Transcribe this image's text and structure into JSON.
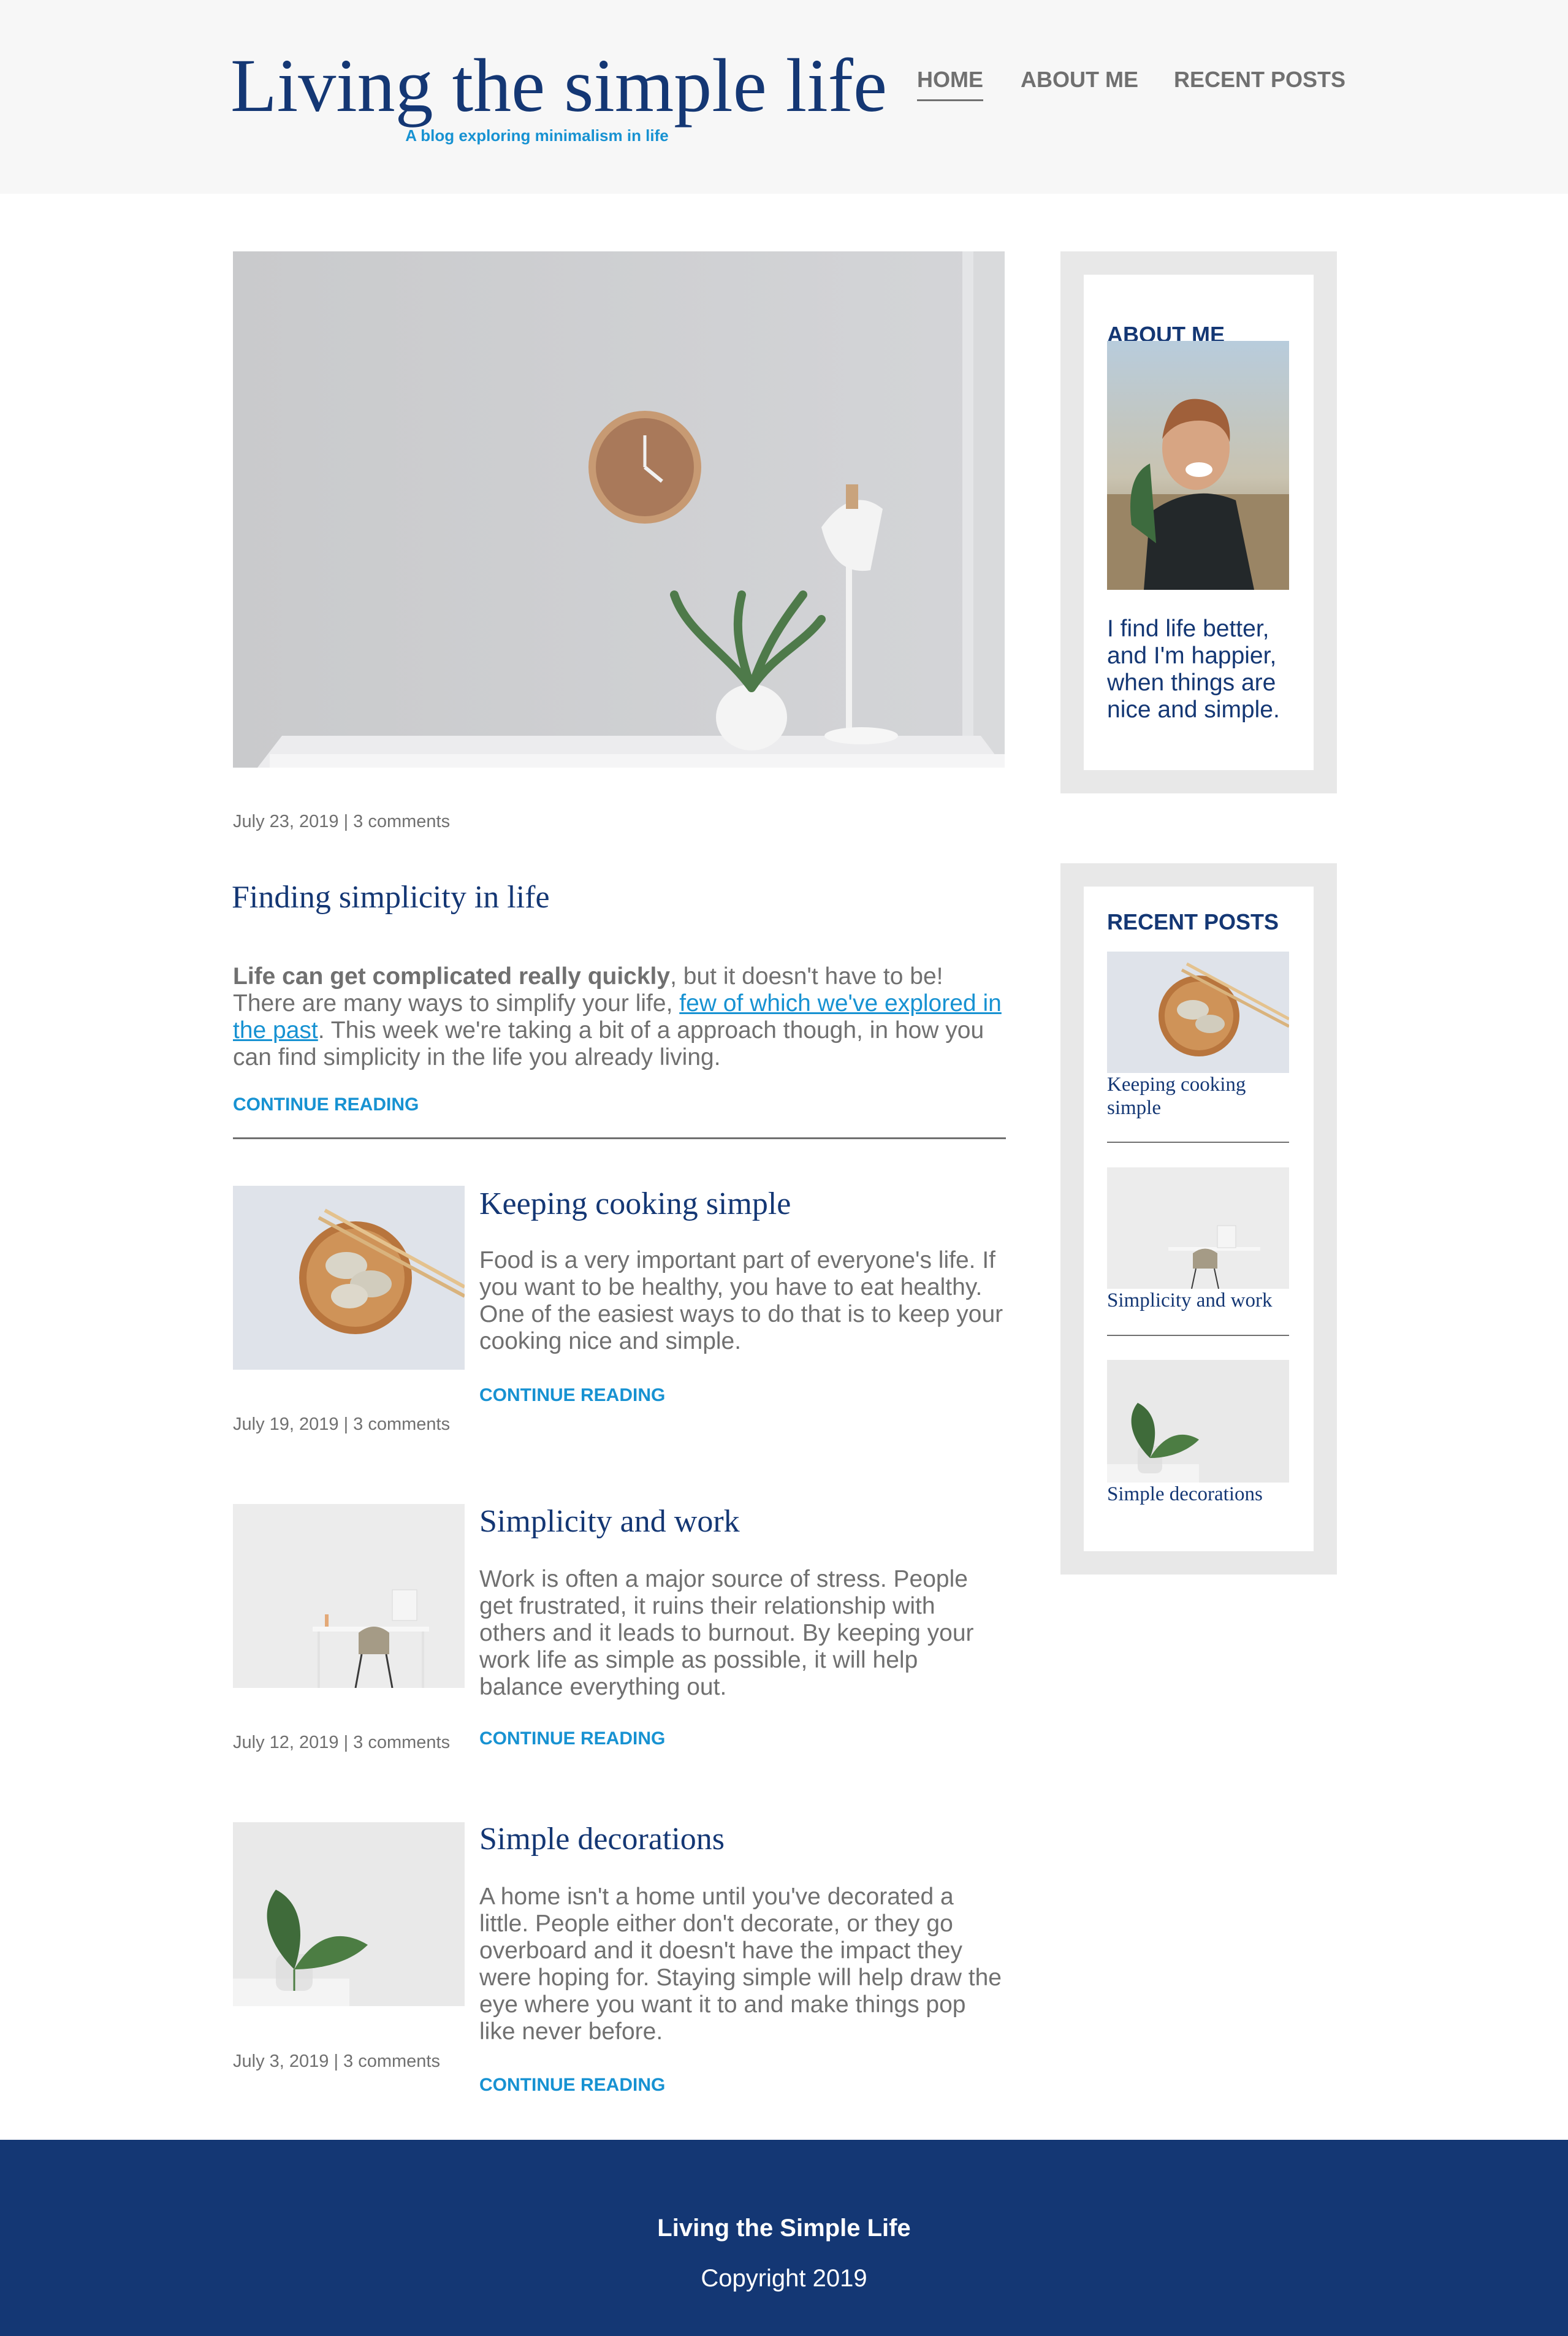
{
  "header": {
    "title": "Living the simple life",
    "subtitle": "A blog exploring minimalism in life",
    "nav": [
      {
        "label": "HOME"
      },
      {
        "label": "ABOUT ME"
      },
      {
        "label": "RECENT POSTS"
      }
    ]
  },
  "featured": {
    "meta": "July 23, 2019 | 3 comments",
    "title": "Finding simplicity in life",
    "body_strong": "Life can get complicated really quickly",
    "body_part1": ", but it doesn't have to be! There are many ways to simplify your life, ",
    "body_link": "few of which we've explored in the past",
    "body_part2": ". This week we're taking a bit of a approach though, in how you can find simplicity in the life you already living.",
    "cta": "CONTINUE READING"
  },
  "posts": [
    {
      "title": "Keeping cooking simple",
      "body": "Food is a very important part of everyone's life. If you want to be healthy, you have to eat healthy. One of the easiest ways to do that is to keep your cooking nice and simple.",
      "cta": "CONTINUE READING",
      "meta": "July 19, 2019 | 3 comments"
    },
    {
      "title": "Simplicity and work",
      "body": "Work is often a major source of stress. People get frustrated, it ruins their relationship with others and it leads to burnout. By keeping your work life as simple as possible, it will help balance everything out.",
      "cta": "CONTINUE READING",
      "meta": "July 12, 2019 | 3 comments"
    },
    {
      "title": "Simple decorations",
      "body": "A home isn't a home until you've decorated a little. People either don't decorate, or they go overboard and it doesn't have the impact they were hoping for. Staying simple will help draw the eye where you want it to and make things pop like never before.",
      "cta": "CONTINUE READING",
      "meta": "July 3, 2019 | 3 comments"
    }
  ],
  "sidebar": {
    "about": {
      "title": "ABOUT ME",
      "text": "I find life better, and I'm happier, when things are nice and simple."
    },
    "recent": {
      "title": "RECENT POSTS",
      "items": [
        {
          "title": "Keeping cooking simple"
        },
        {
          "title": "Simplicity and work"
        },
        {
          "title": "Simple decorations"
        }
      ]
    }
  },
  "footer": {
    "title": "Living the Simple Life",
    "copyright": "Copyright 2019"
  },
  "colors": {
    "brand_navy": "#143774",
    "accent_blue": "#1792d2",
    "body_gray": "#707070",
    "header_bg": "#f7f7f7",
    "sidebar_bg": "#e8e8e8"
  }
}
